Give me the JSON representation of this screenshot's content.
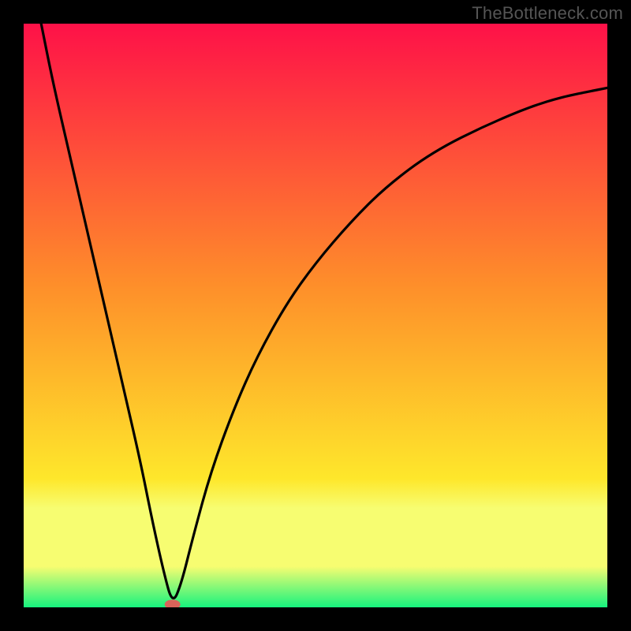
{
  "watermark": "TheBottleneck.com",
  "chart_data": {
    "type": "line",
    "title": "",
    "xlabel": "",
    "ylabel": "",
    "xlim": [
      0,
      100
    ],
    "ylim": [
      0,
      100
    ],
    "background_gradient": {
      "top": "#fe1148",
      "mid_upper": "#fe8f2a",
      "mid_lower": "#fee72b",
      "bottom_band": "#f7fd71",
      "bottom": "#16f37e"
    },
    "series": [
      {
        "name": "bottleneck-curve",
        "color": "#000000",
        "x": [
          3,
          5,
          8,
          11,
          14,
          17,
          20,
          22,
          24,
          25.5,
          27,
          29,
          32,
          36,
          40,
          45,
          50,
          56,
          62,
          70,
          80,
          90,
          100
        ],
        "y": [
          100,
          90,
          77,
          64,
          51,
          38,
          25,
          15,
          6,
          0.5,
          4,
          12,
          23,
          34,
          43,
          52,
          59,
          66,
          72,
          78,
          83,
          87,
          89
        ]
      }
    ],
    "marker": {
      "name": "optimal-point",
      "x": 25.5,
      "y": 0.5,
      "color": "#d9645a",
      "rx": 10,
      "ry": 6
    }
  }
}
